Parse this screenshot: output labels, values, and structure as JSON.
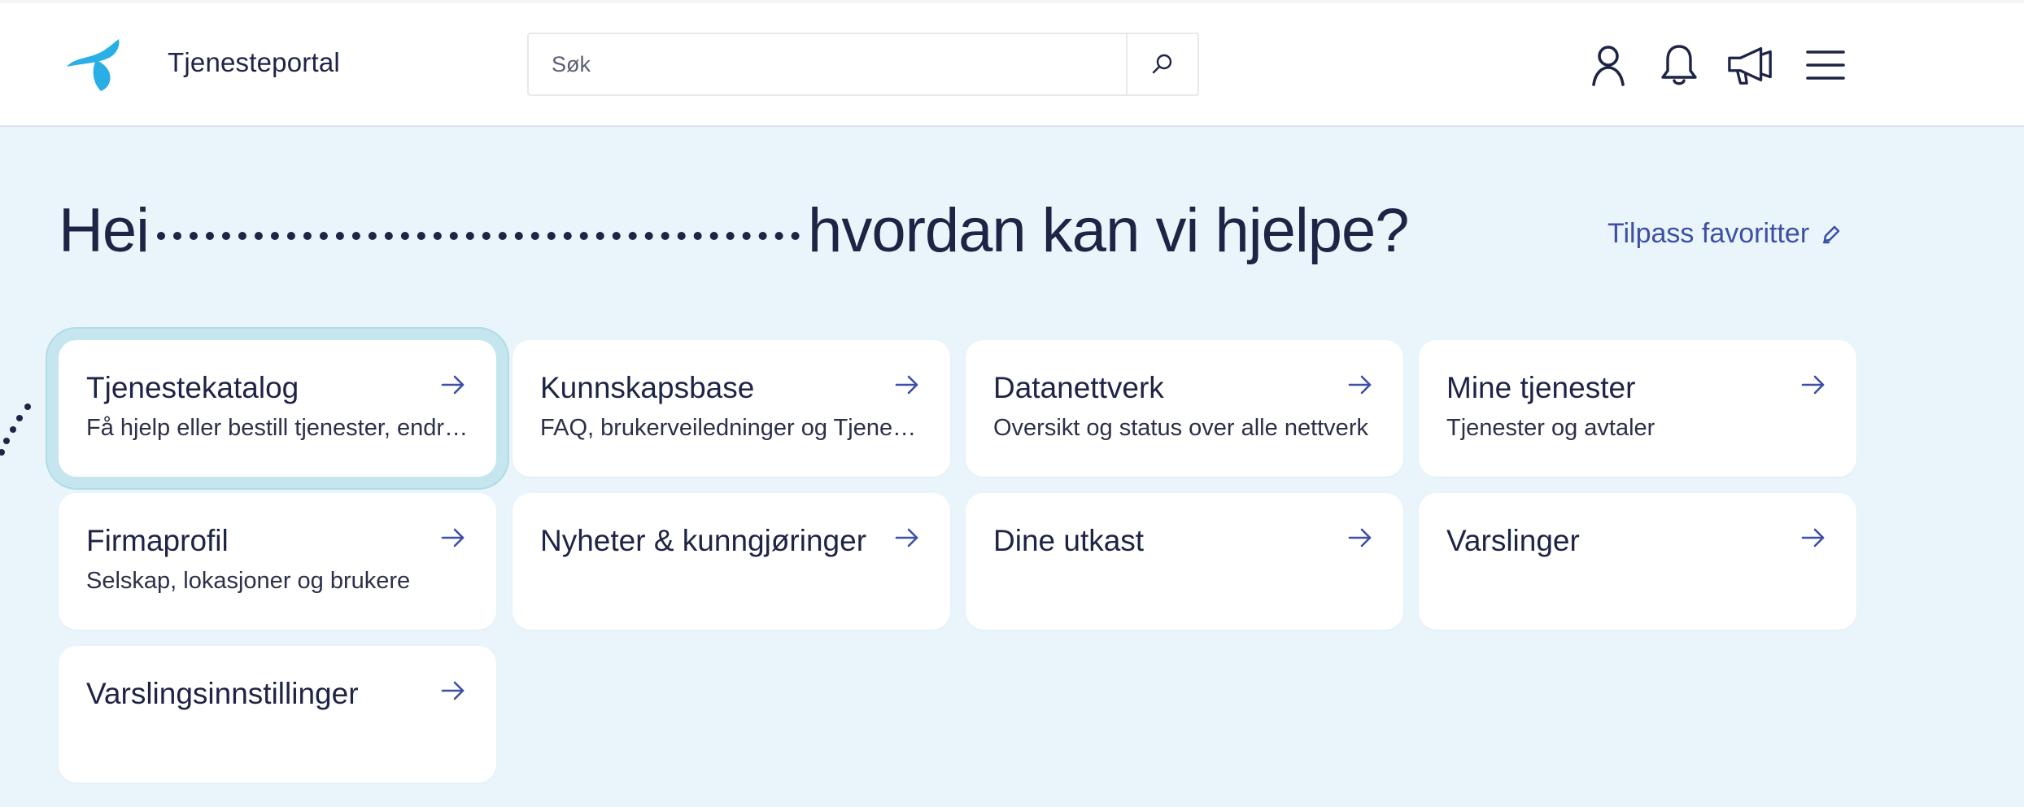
{
  "header": {
    "app_title": "Tjenesteportal",
    "logo_icon": "telenor-logo",
    "search": {
      "placeholder": "Søk",
      "value": "",
      "icon": "search-icon"
    },
    "icons": [
      "user-icon",
      "bell-icon",
      "megaphone-icon",
      "menu-icon"
    ]
  },
  "main": {
    "greeting_prefix": "Hei",
    "greeting_suffix": "hvordan kan vi hjelpe?",
    "customize_label": "Tilpass favoritter",
    "customize_icon": "pencil-icon"
  },
  "cards": [
    {
      "title": "Tjenestekatalog",
      "description": "Få hjelp eller bestill tjenester, endringer og mer"
    },
    {
      "title": "Kunnskapsbase",
      "description": "FAQ, brukerveiledninger og Tjenesteportal-guider"
    },
    {
      "title": "Datanettverk",
      "description": "Oversikt og status over alle nettverk"
    },
    {
      "title": "Mine tjenester",
      "description": "Tjenester og avtaler"
    },
    {
      "title": "Firmaprofil",
      "description": "Selskap, lokasjoner og brukere"
    },
    {
      "title": "Nyheter & kunngjøringer",
      "description": ""
    },
    {
      "title": "Dine utkast",
      "description": ""
    },
    {
      "title": "Varslinger",
      "description": ""
    },
    {
      "title": "Varslingsinnstillinger",
      "description": ""
    }
  ],
  "colors": {
    "background": "#e9f5fa",
    "text": "#1d2445",
    "accent": "#3d4fa6",
    "logo": "#29aee6"
  }
}
